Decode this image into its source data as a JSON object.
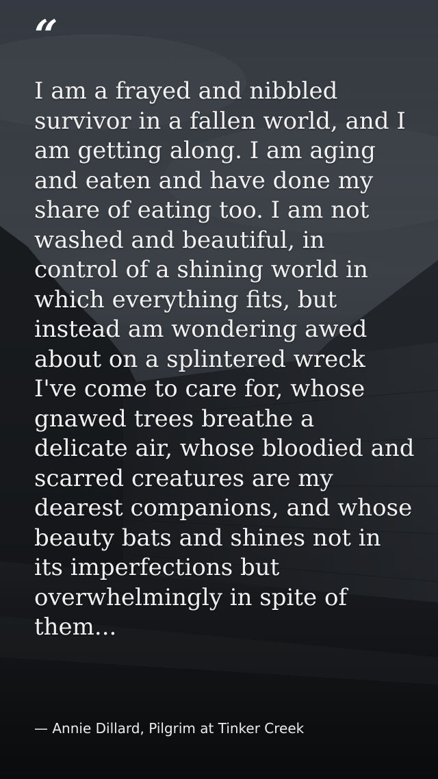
{
  "quote": {
    "mark": "“",
    "text": "I am a frayed and nibbled survivor in a fallen world, and I am getting along. I am aging and eaten and have done my share of eating too. I am not washed and beautiful, in control of a shining world in which everything fits, but instead am wondering awed about on a splintered wreck I've come to care for, whose gnawed trees breathe a delicate air, whose bloodied and scarred creatures are my dearest companions, and whose beauty bats and shines not in its imperfections but overwhelmingly in spite of them..."
  },
  "attribution": "— Annie Dillard, Pilgrim at Tinker Creek",
  "colors": {
    "text": "#f1f1f1",
    "background": "#1c1f24"
  }
}
